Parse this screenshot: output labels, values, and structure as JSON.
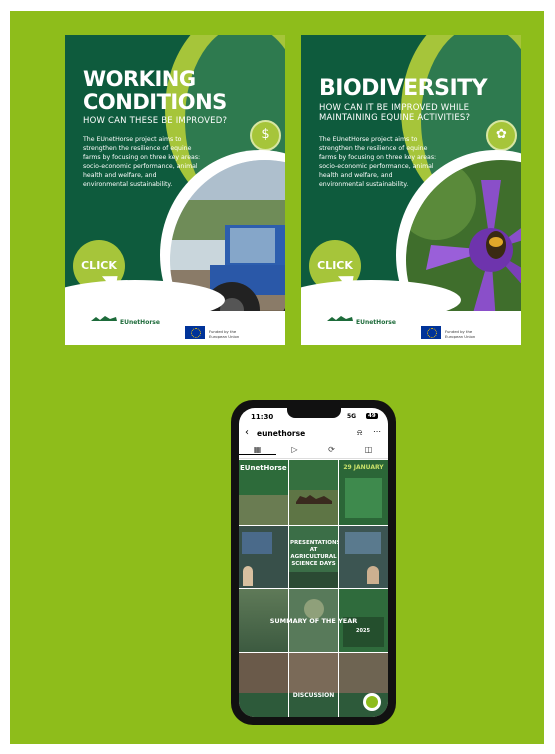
{
  "poster_left": {
    "title_line1": "WORKING",
    "title_line2": "CONDITIONS",
    "subtitle": "HOW CAN THESE BE IMPROVED?",
    "body": "The EUnetHorse project aims to strengthen the resilience of equine farms by focusing on three key areas: socio-economic performance, animal health and welfare, and environmental sustainability.",
    "click_label": "CLICK",
    "logo_name": "EUnetHorse",
    "funded_text": "Funded by the European Union"
  },
  "poster_right": {
    "title_line1": "BIODIVERSITY",
    "subtitle_line1": "HOW CAN IT BE IMPROVED WHILE",
    "subtitle_line2": "MAINTAINING EQUINE ACTIVITIES?",
    "body": "The EUnetHorse project aims to strengthen the resilience of equine farms by focusing on three key areas: socio-economic performance, animal health and welfare, and environmental sustainability.",
    "click_label": "CLICK",
    "logo_name": "EUnetHorse",
    "funded_text": "Funded by the European Union"
  },
  "phone": {
    "time": "11:30",
    "signal": "5G",
    "battery": "49",
    "username": "eunethorse",
    "grid": {
      "post1_title": "EUnetHorse",
      "post2_title": "29 JANUARY",
      "post3_title": "PRESENTATIONS AT AGRICULTURAL SCIENCE DAYS",
      "post4_title": "SUMMARY OF THE YEAR",
      "post4_year": "2025",
      "post5_title": "DISCUSSION"
    }
  },
  "colors": {
    "background": "#8ebd1b",
    "poster_green": "#0e5b3d",
    "accent_lime": "#a6c53a"
  }
}
